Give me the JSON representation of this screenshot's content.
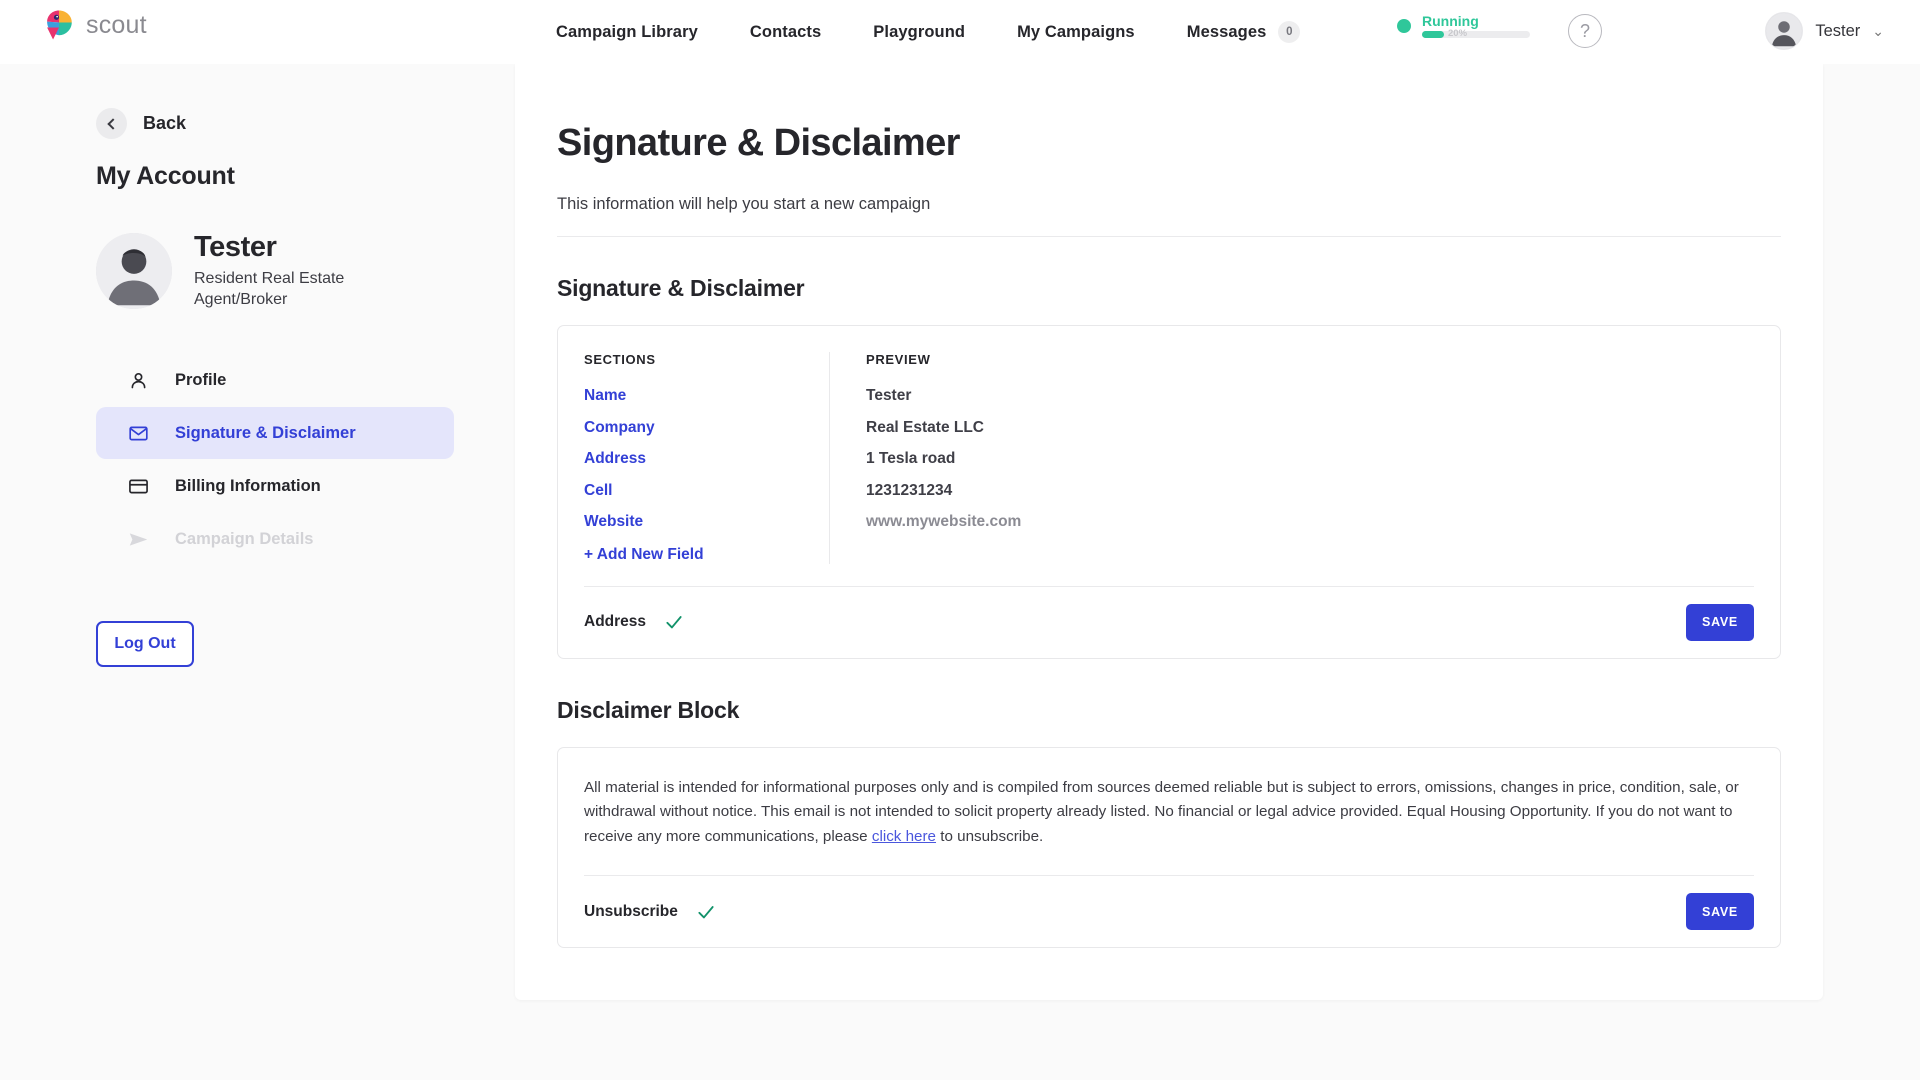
{
  "brand": {
    "name": "scout",
    "logo_icon": "parrot-logo-icon"
  },
  "topnav": {
    "links": [
      {
        "label": "Campaign Library"
      },
      {
        "label": "Contacts"
      },
      {
        "label": "Playground"
      },
      {
        "label": "My Campaigns"
      },
      {
        "label": "Messages",
        "badge": "0"
      }
    ],
    "status": {
      "label": "Running",
      "percent_label": "20%",
      "percent_value": 20,
      "color": "#2fc79a"
    },
    "help_icon": "question-mark-icon",
    "user": {
      "name": "Tester",
      "caret": "⌄"
    }
  },
  "sidebar": {
    "back_label": "Back",
    "account_title": "My Account",
    "profile": {
      "name": "Tester",
      "role": "Resident Real Estate Agent/Broker"
    },
    "items": [
      {
        "label": "Profile",
        "icon": "person-icon",
        "state": "default"
      },
      {
        "label": "Signature & Disclaimer",
        "icon": "envelope-icon",
        "state": "active"
      },
      {
        "label": "Billing Information",
        "icon": "credit-card-icon",
        "state": "default"
      },
      {
        "label": "Campaign Details",
        "icon": "paper-plane-icon",
        "state": "disabled"
      }
    ],
    "logout_label": "Log Out"
  },
  "main": {
    "title": "Signature & Disclaimer",
    "subtitle": "This information will help you start a new campaign",
    "signature_section": {
      "heading": "Signature & Disclaimer",
      "sections_header": "SECTIONS",
      "preview_header": "PREVIEW",
      "sections": [
        "Name",
        "Company",
        "Address",
        "Cell",
        "Website"
      ],
      "add_field_label": "+ Add New Field",
      "preview": [
        "Tester",
        "Real Estate LLC",
        "1 Tesla road",
        "1231231234",
        "www.mywebsite.com"
      ],
      "footer_label": "Address",
      "footer_check_icon": "check-icon",
      "save_label": "SAVE"
    },
    "disclaimer_section": {
      "heading": "Disclaimer Block",
      "text_before_link": "All material is intended for informational purposes only and is compiled from sources deemed reliable but is subject to errors, omissions, changes in price, condition, sale, or withdrawal without notice. This email is not intended to solicit property already listed. No financial or legal advice provided. Equal Housing Opportunity. If you do not want to receive any more communications, please ",
      "link_label": "click here",
      "text_after_link": " to unsubscribe.",
      "footer_label": "Unsubscribe",
      "footer_check_icon": "check-icon",
      "save_label": "SAVE"
    }
  },
  "colors": {
    "accent": "#3340d6",
    "status_green": "#2fc79a",
    "check_green": "#12926a",
    "active_bg": "#e4e5fb"
  }
}
